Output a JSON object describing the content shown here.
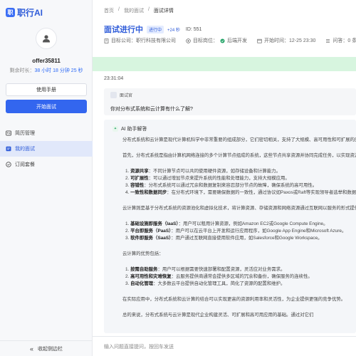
{
  "app": {
    "logo_mark": "职",
    "logo_text": "职行AI"
  },
  "user": {
    "name": "offer35811",
    "remain_prefix": "剩余时长：",
    "remain_time": "38 小时 18 分钟 25 秒"
  },
  "sidebar": {
    "manual_button": "使用手册",
    "start_button": "开始面试",
    "items": [
      {
        "label": "简历管理",
        "icon": "resume-icon"
      },
      {
        "label": "我的面试",
        "icon": "interview-icon"
      },
      {
        "label": "订阅套餐",
        "icon": "subscription-icon"
      }
    ],
    "collapse_label": "收起侧边栏"
  },
  "breadcrumb": [
    "首页",
    "/",
    "我的面试",
    "/",
    "面试详情"
  ],
  "header": {
    "title": "面试进行中",
    "status_badge": "进行中",
    "seconds_badge": "+24 秒",
    "id_label": "ID: 551",
    "company_label": "目标公司：职行科技有限公司",
    "position_label": "目标岗位：",
    "position_value": "后端开发",
    "start_time_label": "开始时间：12-25 23:30",
    "questions_label": "问答：0 条"
  },
  "colors": {
    "accent": "#3366ef",
    "banner": "#d7f5df"
  },
  "chat": {
    "timestamp": "23:31:04",
    "question_role": "面试官",
    "question_text": "你对分布式系统和云计算有什么了解?",
    "answer_role": "AI 助手解答",
    "answer_lines": [
      {
        "t": "分布式系统和云计算是现代计算机科学中非常重要的组成部分，它们密切相关，支持了大规模、高可用性和可扩展的应用程序。",
        "k": "p"
      },
      {
        "t": "首先，分布式系统是指由计算机网络连接的多个计算节点组成的系统，这些节点共享资源并协同完成任务，以实现资源的共享和任务的并行处理。",
        "k": "p"
      },
      {
        "n": "1.",
        "b": "资源共享",
        "t": "：不同计算节点可以共同使用硬件资源，如存储设备和计算能力。",
        "k": "li"
      },
      {
        "n": "2.",
        "b": "可扩展性",
        "t": "：可以通过增加节点来提升系统的性能和处理能力，支持大规模应用。",
        "k": "li"
      },
      {
        "n": "3.",
        "b": "容错性",
        "t": "：分布式系统可以通过冗余和数据复制来容忍部分节点的故障，确保系统的高可用性。",
        "k": "li"
      },
      {
        "n": "4.",
        "b": "一致性和数据同步",
        "t": "：在分布式环境下，需要确保数据的一致性，通过协议如Paxos或Raft等实现领导者选举和数据同步。",
        "k": "li"
      },
      {
        "t": "云计算则是基于分布式系统的资源池化和虚拟化技术，将计算资源、存储资源和网络资源通过互联网以服务的形式提供给用户。",
        "k": "p"
      },
      {
        "n": "1.",
        "b": "基础设施即服务（IaaS）",
        "t": "：用户可以租用计算资源，例如Amazon EC2或Google Compute Engine。",
        "k": "li"
      },
      {
        "n": "2.",
        "b": "平台即服务（PaaS）",
        "t": "：用户可以在云平台上开发和运行应用程序，如Google App Engine和Microsoft Azure。",
        "k": "li"
      },
      {
        "n": "3.",
        "b": "软件即服务（SaaS）",
        "t": "：用户通过互联网直接使用软件应用，如Salesforce和Google Workspace。",
        "k": "li"
      },
      {
        "t": "云计算的优势包括：",
        "k": "p"
      },
      {
        "n": "1.",
        "b": "按需自助服务",
        "t": "：用户可以根据需要快速部署和配置资源，灵活应对业务需求。",
        "k": "li"
      },
      {
        "n": "2.",
        "b": "高可用性和灾难恢复",
        "t": "：云服务提供商通常会提供多区域的冗余和备份，确保服务的连续性。",
        "k": "li"
      },
      {
        "n": "3.",
        "b": "自动化管理",
        "t": "：大多数云平台提供自动化管理工具，简化了资源的配置和维护。",
        "k": "li"
      },
      {
        "t": "在实际应用中，分布式系统和云计算的结合可以实现更高的资源利用率和灵活性，为企业提供更强的竞争优势。",
        "k": "p"
      },
      {
        "t": "总的来说，分布式系统与云计算是现代企业构建灵活、可扩展和高可用应用的基础。通过对它们",
        "k": "p"
      }
    ]
  },
  "input": {
    "placeholder": "输入问题直接提问，按回车发送"
  }
}
